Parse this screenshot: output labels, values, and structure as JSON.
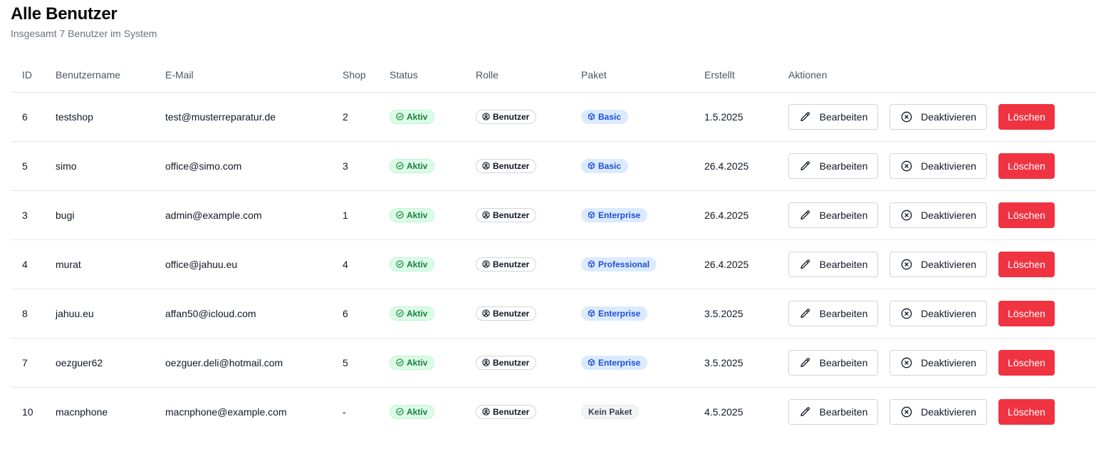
{
  "header": {
    "title": "Alle Benutzer",
    "subtitle": "Insgesamt 7 Benutzer im System"
  },
  "table": {
    "columns": [
      "ID",
      "Benutzername",
      "E-Mail",
      "Shop",
      "Status",
      "Rolle",
      "Paket",
      "Erstellt",
      "Aktionen"
    ],
    "action_labels": {
      "edit": "Bearbeiten",
      "deactivate": "Deaktivieren",
      "delete": "Löschen"
    },
    "rows": [
      {
        "id": "6",
        "username": "testshop",
        "email": "test@musterreparatur.de",
        "shop": "2",
        "status": "Aktiv",
        "role": "Benutzer",
        "plan": "Basic",
        "plan_kind": "plan",
        "created": "1.5.2025"
      },
      {
        "id": "5",
        "username": "simo",
        "email": "office@simo.com",
        "shop": "3",
        "status": "Aktiv",
        "role": "Benutzer",
        "plan": "Basic",
        "plan_kind": "plan",
        "created": "26.4.2025"
      },
      {
        "id": "3",
        "username": "bugi",
        "email": "admin@example.com",
        "shop": "1",
        "status": "Aktiv",
        "role": "Benutzer",
        "plan": "Enterprise",
        "plan_kind": "plan",
        "created": "26.4.2025"
      },
      {
        "id": "4",
        "username": "murat",
        "email": "office@jahuu.eu",
        "shop": "4",
        "status": "Aktiv",
        "role": "Benutzer",
        "plan": "Professional",
        "plan_kind": "plan",
        "created": "26.4.2025"
      },
      {
        "id": "8",
        "username": "jahuu.eu",
        "email": "affan50@icloud.com",
        "shop": "6",
        "status": "Aktiv",
        "role": "Benutzer",
        "plan": "Enterprise",
        "plan_kind": "plan",
        "created": "3.5.2025"
      },
      {
        "id": "7",
        "username": "oezguer62",
        "email": "oezguer.deli@hotmail.com",
        "shop": "5",
        "status": "Aktiv",
        "role": "Benutzer",
        "plan": "Enterprise",
        "plan_kind": "plan",
        "created": "3.5.2025"
      },
      {
        "id": "10",
        "username": "macnphone",
        "email": "macnphone@example.com",
        "shop": "-",
        "status": "Aktiv",
        "role": "Benutzer",
        "plan": "Kein Paket",
        "plan_kind": "none",
        "created": "4.5.2025"
      }
    ]
  },
  "icons": {
    "status": "check-circle-icon",
    "role": "user-circle-icon",
    "plan": "package-icon",
    "edit": "pencil-icon",
    "deactivate": "x-circle-icon"
  },
  "colors": {
    "status_bg": "#dcfce7",
    "status_text": "#15803d",
    "plan_bg": "#dbeafe",
    "plan_text": "#1d4ed8",
    "delete_bg": "#ef3340"
  }
}
